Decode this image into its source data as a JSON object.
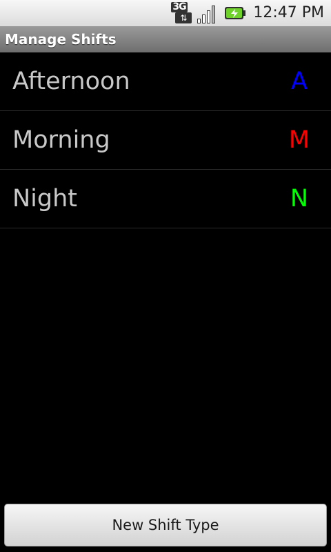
{
  "status_bar": {
    "network_label": "3G",
    "time": "12:47 PM",
    "icons": [
      "3g-data-icon",
      "signal-strength-icon",
      "battery-charging-icon"
    ]
  },
  "title_bar": {
    "title": "Manage Shifts"
  },
  "shifts": [
    {
      "name": "Afternoon",
      "code": "A",
      "color": "#0000ff"
    },
    {
      "name": "Morning",
      "code": "M",
      "color": "#ff0000"
    },
    {
      "name": "Night",
      "code": "N",
      "color": "#00ff00"
    }
  ],
  "actions": {
    "new_shift_label": "New Shift Type"
  }
}
